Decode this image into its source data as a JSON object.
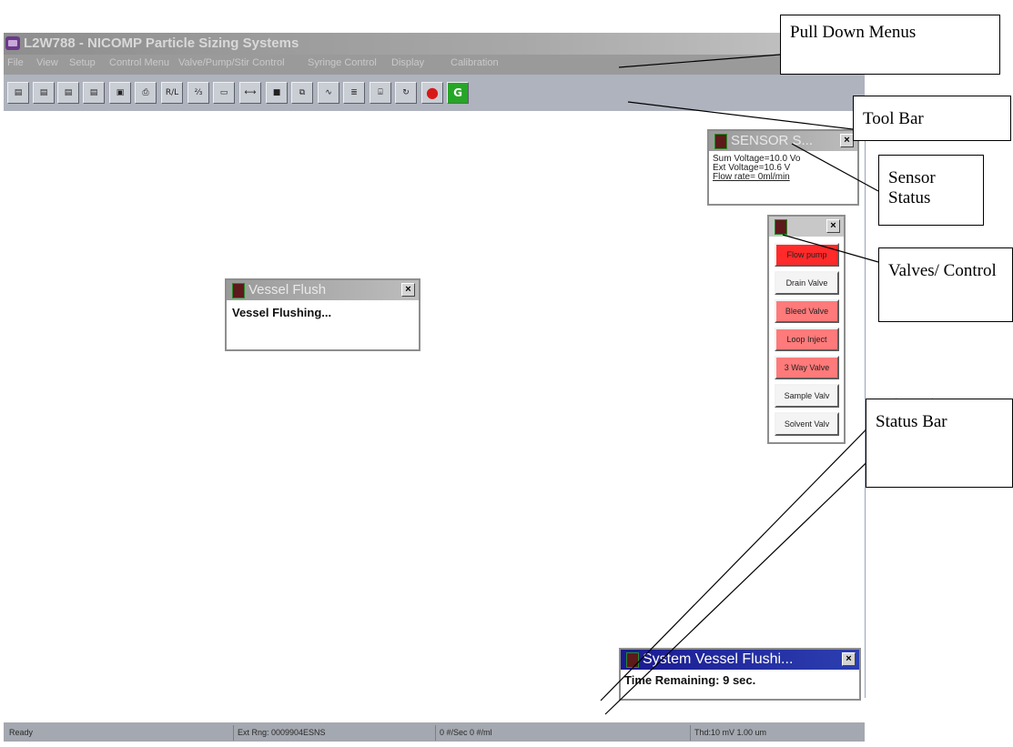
{
  "window": {
    "title": "L2W788  - NICOMP Particle Sizing Systems"
  },
  "menu": [
    {
      "label": "File"
    },
    {
      "label": "View"
    },
    {
      "label": "Setup"
    },
    {
      "label": "Control Menu"
    },
    {
      "label": "Valve/Pump/Stir Control"
    },
    {
      "label": "Syringe Control"
    },
    {
      "label": "Display"
    },
    {
      "label": "Calibration"
    }
  ],
  "toolbar": {
    "buttons": [
      {
        "icon": "open-folder-icon",
        "glyph": "▤"
      },
      {
        "icon": "open-folder-icon",
        "glyph": "▤"
      },
      {
        "icon": "open-folder-icon",
        "glyph": "▤"
      },
      {
        "icon": "open-folder-icon",
        "glyph": "▤"
      },
      {
        "icon": "save-icon",
        "glyph": "▣"
      },
      {
        "icon": "print-icon",
        "glyph": "⎙"
      },
      {
        "icon": "rl-icon",
        "glyph": "R/L"
      },
      {
        "icon": "chart-icon",
        "glyph": "⅔"
      },
      {
        "icon": "bar-icon",
        "glyph": "▭"
      },
      {
        "icon": "range-icon",
        "glyph": "⟷"
      },
      {
        "icon": "square-icon",
        "glyph": "■"
      },
      {
        "icon": "windows-icon",
        "glyph": "⧉"
      },
      {
        "icon": "wave-icon",
        "glyph": "∿"
      },
      {
        "icon": "list-icon",
        "glyph": "≣"
      },
      {
        "icon": "device-icon",
        "glyph": "⌸"
      },
      {
        "icon": "cycle-icon",
        "glyph": "↻"
      },
      {
        "icon": "stop-icon",
        "glyph": "●"
      },
      {
        "icon": "go-icon",
        "glyph": "G"
      }
    ],
    "colors": {
      "stop": "#d81818",
      "go": "#26a626"
    }
  },
  "sensor_window": {
    "title": "SENSOR S...",
    "lines": [
      "Sum Voltage=10.0 Vo",
      "Ext Voltage=10.6 V",
      "Flow rate= 0ml/min"
    ]
  },
  "valves_window": {
    "buttons": [
      {
        "label": "Flow pump",
        "color": "#ff2a2a"
      },
      {
        "label": "Drain Valve",
        "color": "#f4f4f4"
      },
      {
        "label": "Bleed Valve",
        "color": "#ff7a7a"
      },
      {
        "label": "Loop Inject",
        "color": "#ff7a7a"
      },
      {
        "label": "3 Way Valve",
        "color": "#ff7a7a"
      },
      {
        "label": "Sample Valv",
        "color": "#f4f4f4"
      },
      {
        "label": "Solvent Valv",
        "color": "#f4f4f4"
      }
    ]
  },
  "vessel_flush_window": {
    "title": "Vessel Flush",
    "message": "Vessel Flushing..."
  },
  "system_window": {
    "title": "System Vessel Flushi...",
    "message": "Time Remaining: 9 sec."
  },
  "status": {
    "ready": "Ready",
    "ext_rng": "Ext Rng: 0009904ESNS",
    "rate": "0 #/Sec  0 #/ml",
    "thd": "Thd:10 mV 1.00 um"
  },
  "callouts": {
    "pull_down": "Pull Down  Menus",
    "tool_bar": "Tool Bar",
    "sensor": "Sensor Status",
    "valves": "Valves/ Control",
    "status_bar": "Status Bar"
  }
}
